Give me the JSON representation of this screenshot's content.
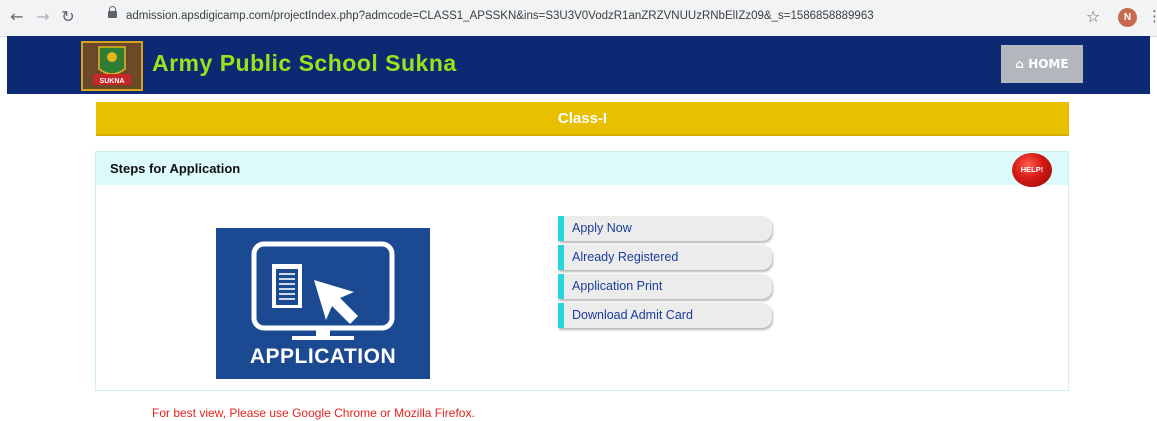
{
  "browser": {
    "url": "admission.apsdigicamp.com/projectIndex.php?admcode=CLASS1_APSSKN&ins=S3U3V0VodzR1anZRZVNUUzRNbElIZz09&_s=1586858889963",
    "avatar_initial": "N"
  },
  "header": {
    "school_name": "Army Public School Sukna",
    "logo_text": "SUKNA",
    "home_label": "HOME",
    "colors": {
      "header_bg": "#0b2a73",
      "title": "#9be21b"
    }
  },
  "class_bar": {
    "title": "Class-I",
    "color": "#e8c000"
  },
  "steps": {
    "heading": "Steps for Application",
    "help_label": "HELP!",
    "image_label": "APPLICATION",
    "menu": [
      {
        "label": "Apply Now"
      },
      {
        "label": "Already Registered"
      },
      {
        "label": "Application Print"
      },
      {
        "label": "Download Admit Card"
      }
    ]
  },
  "footer_note": "For best view, Please use Google Chrome or Mozilla Firefox."
}
